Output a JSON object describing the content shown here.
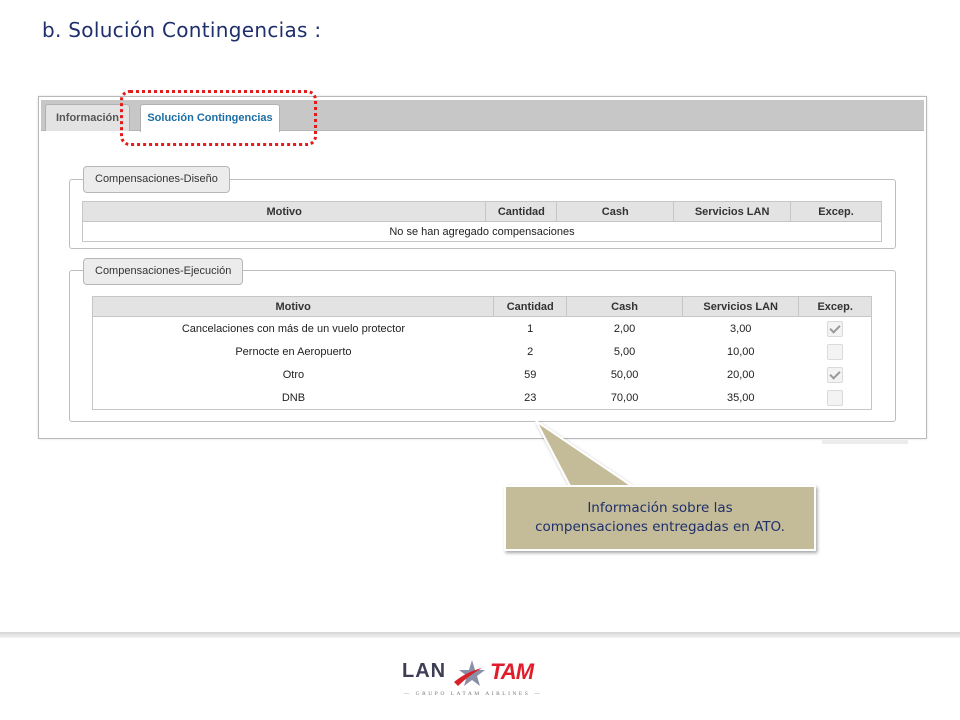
{
  "slide": {
    "title": "b. Solución Contingencias  :"
  },
  "tabs": {
    "info_label": "Información",
    "solucion_label": "Solución Contingencias"
  },
  "diseno": {
    "legend": "Compensaciones-Diseño",
    "columns": [
      "Motivo",
      "Cantidad",
      "Cash",
      "Servicios LAN",
      "Excep."
    ],
    "empty_message": "No se han agregado compensaciones"
  },
  "ejecucion": {
    "legend": "Compensaciones-Ejecución",
    "columns": [
      "Motivo",
      "Cantidad",
      "Cash",
      "Servicios LAN",
      "Excep."
    ],
    "rows": [
      {
        "motivo": "Cancelaciones con más de un vuelo protector",
        "cantidad": "1",
        "cash": "2,00",
        "servicios": "3,00",
        "excep": true
      },
      {
        "motivo": "Pernocte en Aeropuerto",
        "cantidad": "2",
        "cash": "5,00",
        "servicios": "10,00",
        "excep": false
      },
      {
        "motivo": "Otro",
        "cantidad": "59",
        "cash": "50,00",
        "servicios": "20,00",
        "excep": true
      },
      {
        "motivo": "DNB",
        "cantidad": "23",
        "cash": "70,00",
        "servicios": "35,00",
        "excep": false
      }
    ]
  },
  "callout": {
    "line1": "Información sobre las",
    "line2": "compensaciones entregadas en ATO."
  },
  "logo": {
    "lan": "LAN",
    "tam": "TAM",
    "sub": "— GRUPO LATAM AIRLINES —"
  },
  "colors": {
    "title": "#1f2f6b",
    "highlight": "#e41b1b",
    "callout_fill": "#c4bc98",
    "active_tab": "#1c6ea4"
  }
}
